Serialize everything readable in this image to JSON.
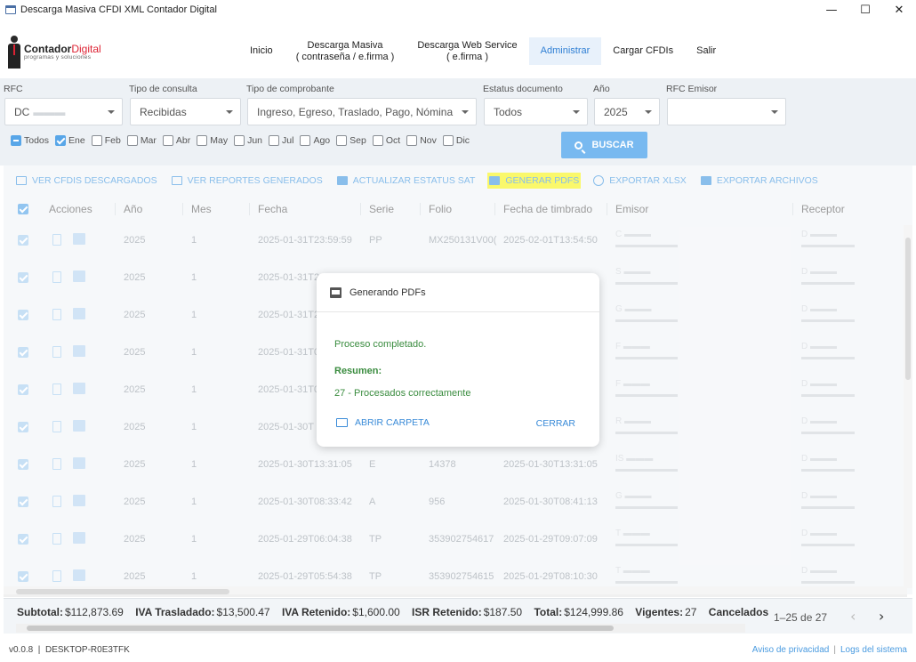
{
  "window": {
    "title": "Descarga Masiva CFDI XML Contador Digital",
    "controls": [
      "—",
      "☐",
      "✕"
    ]
  },
  "logo": {
    "name_a": "Contador",
    "name_b": "Digital",
    "tagline": "programas y soluciones"
  },
  "nav": [
    {
      "label": "Inicio",
      "active": false
    },
    {
      "label": "Descarga Masiva",
      "label2": "( contraseña / e.firma )",
      "active": false
    },
    {
      "label": "Descarga Web Service",
      "label2": "( e.firma )",
      "active": false
    },
    {
      "label": "Administrar",
      "active": true
    },
    {
      "label": "Cargar CFDIs",
      "active": false
    },
    {
      "label": "Salir",
      "active": false
    }
  ],
  "filters": {
    "rfc": {
      "label": "RFC",
      "value": "DC"
    },
    "tipo_consulta": {
      "label": "Tipo de consulta",
      "value": "Recibidas"
    },
    "tipo_comprobante": {
      "label": "Tipo de comprobante",
      "value": "Ingreso, Egreso, Traslado, Pago, Nómina"
    },
    "estatus": {
      "label": "Estatus documento",
      "value": "Todos"
    },
    "anio": {
      "label": "Año",
      "value": "2025"
    },
    "rfc_emisor": {
      "label": "RFC Emisor",
      "value": ""
    },
    "months": [
      {
        "label": "Todos",
        "state": "indeterminate"
      },
      {
        "label": "Ene",
        "state": "checked"
      },
      {
        "label": "Feb",
        "state": "unchecked"
      },
      {
        "label": "Mar",
        "state": "unchecked"
      },
      {
        "label": "Abr",
        "state": "unchecked"
      },
      {
        "label": "May",
        "state": "unchecked"
      },
      {
        "label": "Jun",
        "state": "unchecked"
      },
      {
        "label": "Jul",
        "state": "unchecked"
      },
      {
        "label": "Ago",
        "state": "unchecked"
      },
      {
        "label": "Sep",
        "state": "unchecked"
      },
      {
        "label": "Oct",
        "state": "unchecked"
      },
      {
        "label": "Nov",
        "state": "unchecked"
      },
      {
        "label": "Dic",
        "state": "unchecked"
      }
    ],
    "search_label": "BUSCAR"
  },
  "toolbar": [
    {
      "label": "VER CFDIS DESCARGADOS",
      "icon": "folder-icon"
    },
    {
      "label": "VER REPORTES GENERADOS",
      "icon": "folder-icon"
    },
    {
      "label": "ACTUALIZAR ESTATUS SAT",
      "icon": "sat-icon"
    },
    {
      "label": "GENERAR PDFS",
      "icon": "pdf-icon",
      "highlighted": true
    },
    {
      "label": "EXPORTAR XLSX",
      "icon": "download-icon"
    },
    {
      "label": "EXPORTAR ARCHIVOS",
      "icon": "export-icon"
    }
  ],
  "table": {
    "headers": [
      "Acciones",
      "Año",
      "Mes",
      "Fecha",
      "Serie",
      "Folio",
      "Fecha de timbrado",
      "Emisor",
      "Receptor"
    ],
    "rows": [
      {
        "anio": "2025",
        "mes": "1",
        "fecha": "2025-01-31T23:59:59",
        "serie": "PP",
        "folio": "MX250131V00(",
        "timbrado": "2025-02-01T13:54:50"
      },
      {
        "anio": "2025",
        "mes": "1",
        "fecha": "2025-01-31T2",
        "serie": "",
        "folio": "",
        "timbrado": ""
      },
      {
        "anio": "2025",
        "mes": "1",
        "fecha": "2025-01-31T2",
        "serie": "",
        "folio": "",
        "timbrado": ""
      },
      {
        "anio": "2025",
        "mes": "1",
        "fecha": "2025-01-31T0",
        "serie": "",
        "folio": "",
        "timbrado": ""
      },
      {
        "anio": "2025",
        "mes": "1",
        "fecha": "2025-01-31T0",
        "serie": "",
        "folio": "",
        "timbrado": ""
      },
      {
        "anio": "2025",
        "mes": "1",
        "fecha": "2025-01-30T",
        "serie": "",
        "folio": "",
        "timbrado": ""
      },
      {
        "anio": "2025",
        "mes": "1",
        "fecha": "2025-01-30T13:31:05",
        "serie": "E",
        "folio": "14378",
        "timbrado": "2025-01-30T13:31:05"
      },
      {
        "anio": "2025",
        "mes": "1",
        "fecha": "2025-01-30T08:33:42",
        "serie": "A",
        "folio": "956",
        "timbrado": "2025-01-30T08:41:13"
      },
      {
        "anio": "2025",
        "mes": "1",
        "fecha": "2025-01-29T06:04:38",
        "serie": "TP",
        "folio": "353902754617",
        "timbrado": "2025-01-29T09:07:09"
      },
      {
        "anio": "2025",
        "mes": "1",
        "fecha": "2025-01-29T05:54:38",
        "serie": "TP",
        "folio": "353902754615",
        "timbrado": "2025-01-29T08:10:30"
      }
    ],
    "emisor_snippets": [
      "C",
      "S",
      "G",
      "F",
      "F",
      "R",
      "IS",
      "G",
      "T",
      "T"
    ],
    "receptor_snippets": [
      "D",
      "D",
      "D",
      "D",
      "D",
      "D",
      "D",
      "D",
      "D",
      "D"
    ]
  },
  "totals": {
    "subtotal_label": "Subtotal:",
    "subtotal": "$112,873.69",
    "iva_tras_label": "IVA Trasladado:",
    "iva_tras": "$13,500.47",
    "iva_ret_label": "IVA Retenido:",
    "iva_ret": "$1,600.00",
    "isr_ret_label": "ISR Retenido:",
    "isr_ret": "$187.50",
    "total_label": "Total:",
    "total": "$124,999.86",
    "vigentes_label": "Vigentes:",
    "vigentes": "27",
    "cancelados_label": "Cancelados",
    "pager": "1–25 de 27"
  },
  "status": {
    "version": "v0.0.8",
    "host": "DESKTOP-R0E3TFK",
    "privacy": "Aviso de privacidad",
    "logs": "Logs del sistema"
  },
  "dialog": {
    "title": "Generando PDFs",
    "message": "Proceso completado.",
    "summary_label": "Resumen:",
    "result": "27 - Procesados correctamente",
    "open_folder": "ABRIR CARPETA",
    "close": "CERRAR"
  }
}
